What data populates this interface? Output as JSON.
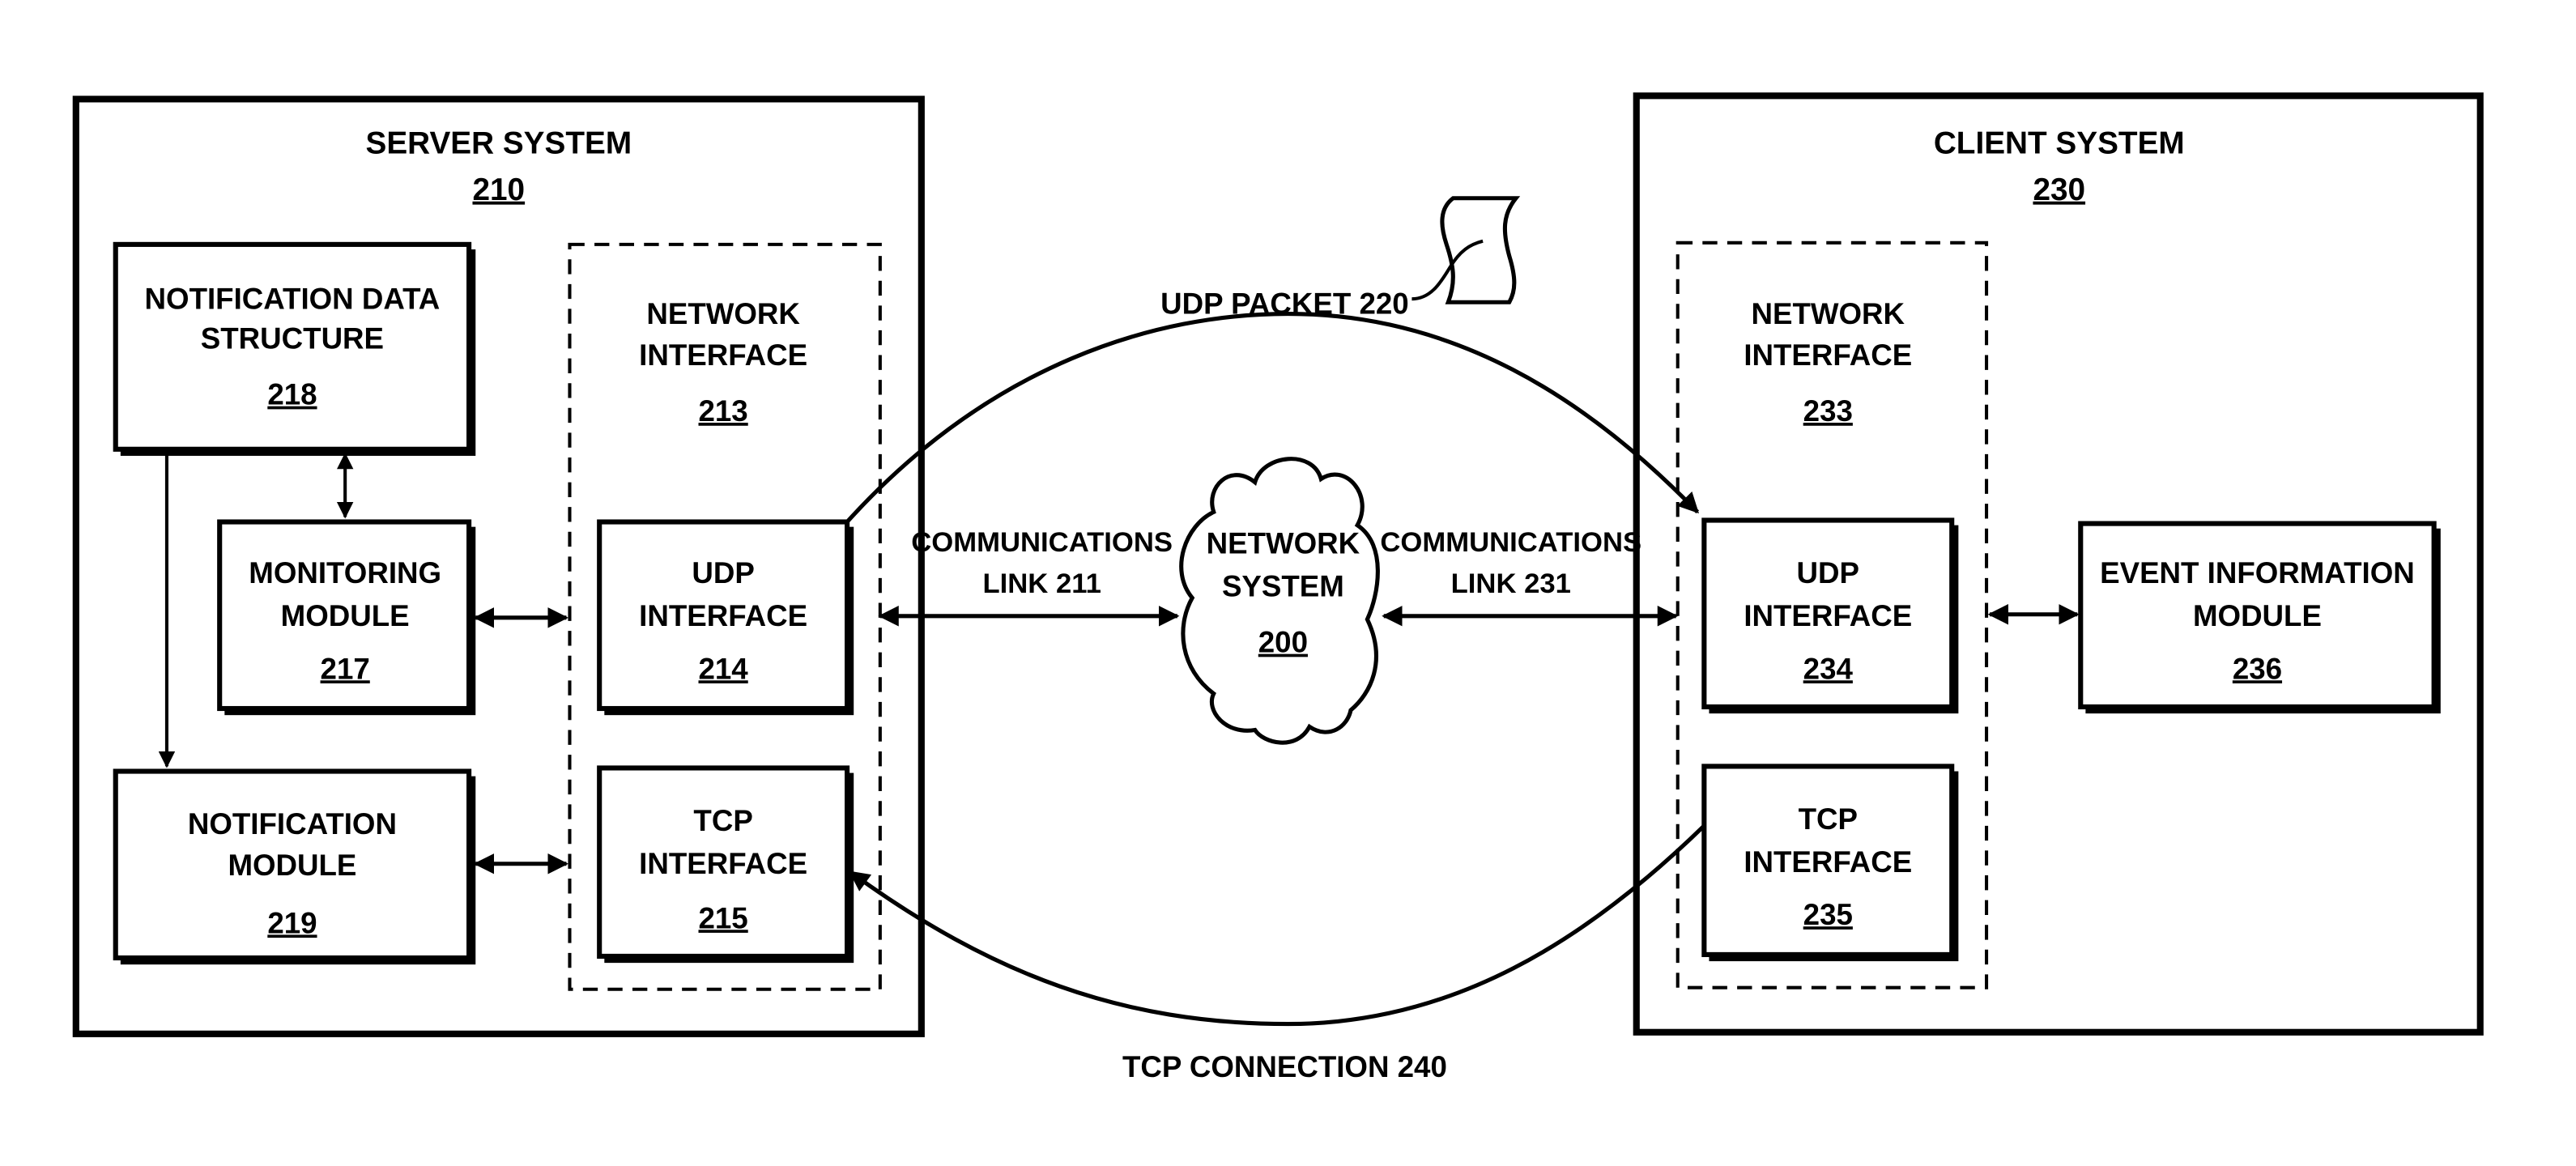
{
  "server": {
    "title": "SERVER SYSTEM",
    "ref": "210",
    "notification_data_structure": {
      "line1": "NOTIFICATION DATA",
      "line2": "STRUCTURE",
      "ref": "218"
    },
    "monitoring_module": {
      "line1": "MONITORING",
      "line2": "MODULE",
      "ref": "217"
    },
    "notification_module": {
      "line1": "NOTIFICATION",
      "line2": "MODULE",
      "ref": "219"
    },
    "network_interface": {
      "line1": "NETWORK",
      "line2": "INTERFACE",
      "ref": "213"
    },
    "udp_interface": {
      "line1": "UDP",
      "line2": "INTERFACE",
      "ref": "214"
    },
    "tcp_interface": {
      "line1": "TCP",
      "line2": "INTERFACE",
      "ref": "215"
    }
  },
  "client": {
    "title": "CLIENT SYSTEM",
    "ref": "230",
    "network_interface": {
      "line1": "NETWORK",
      "line2": "INTERFACE",
      "ref": "233"
    },
    "udp_interface": {
      "line1": "UDP",
      "line2": "INTERFACE",
      "ref": "234"
    },
    "tcp_interface": {
      "line1": "TCP",
      "line2": "INTERFACE",
      "ref": "235"
    },
    "event_information_module": {
      "line1": "EVENT INFORMATION",
      "line2": "MODULE",
      "ref": "236"
    }
  },
  "network": {
    "line1": "NETWORK",
    "line2": "SYSTEM",
    "ref": "200"
  },
  "links": {
    "server_link": {
      "line1": "COMMUNICATIONS",
      "line2": "LINK 211"
    },
    "client_link": {
      "line1": "COMMUNICATIONS",
      "line2": "LINK 231"
    }
  },
  "udp_packet_label": "UDP PACKET 220",
  "tcp_connection_label": "TCP CONNECTION 240"
}
